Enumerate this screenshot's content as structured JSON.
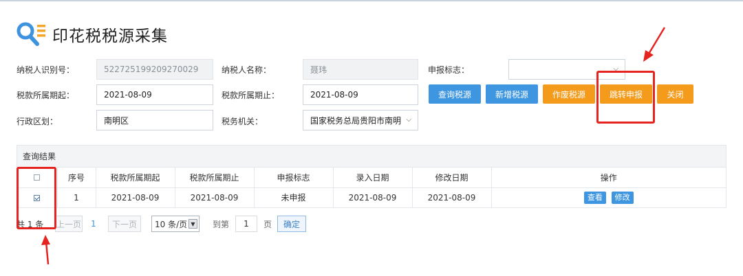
{
  "page": {
    "title": "印花税税源采集"
  },
  "form": {
    "taxpayer_id_label": "纳税人识别号：",
    "taxpayer_id_value": "522725199209270029",
    "taxpayer_name_label": "纳税人名称：",
    "taxpayer_name_value": "聂玮",
    "declare_flag_label": "申报标志：",
    "declare_flag_value": "",
    "period_start_label": "税款所属期起：",
    "period_start_value": "2021-08-09",
    "period_end_label": "税款所属期止：",
    "period_end_value": "2021-08-09",
    "region_label": "行政区划：",
    "region_value": "南明区",
    "tax_office_label": "税务机关：",
    "tax_office_value": "国家税务总局贵阳市南明"
  },
  "actions": {
    "query": "查询税源",
    "add": "新增税源",
    "void": "作废税源",
    "jump": "跳转申报",
    "close": "关闭"
  },
  "results": {
    "title": "查询结果",
    "columns": [
      "序号",
      "税款所属期起",
      "税款所属期止",
      "申报标志",
      "录入日期",
      "修改日期",
      "操作"
    ],
    "rows": [
      {
        "index": "1",
        "start": "2021-08-09",
        "end": "2021-08-09",
        "flag": "未申报",
        "entry_date": "2021-08-09",
        "modified_date": "2021-08-09",
        "view": "查看",
        "edit": "修改",
        "checked": true
      }
    ]
  },
  "pager": {
    "total": "共 1 条",
    "prev": "上一页",
    "current": "1",
    "next": "下一页",
    "page_size": "10 条/页",
    "goto_prefix": "到第",
    "goto_value": "1",
    "goto_suffix": "页",
    "confirm": "确定"
  },
  "colors": {
    "primary": "#3e95e0",
    "warning": "#f49b1c",
    "highlight": "#e5231f"
  }
}
